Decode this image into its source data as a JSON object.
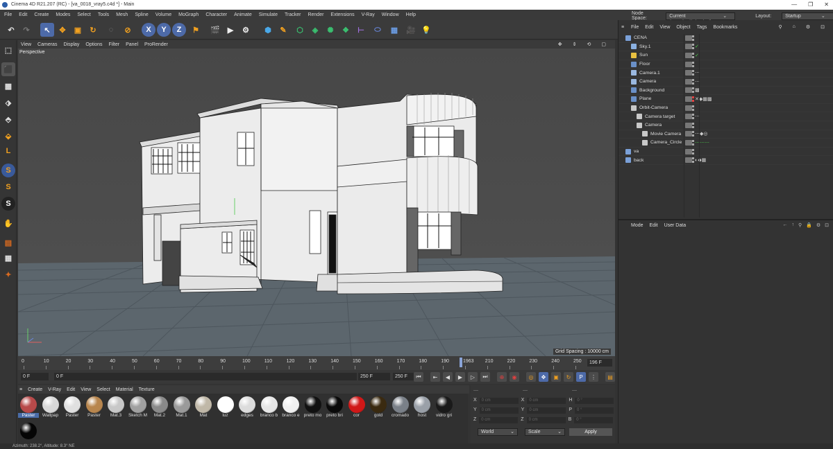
{
  "window": {
    "title": "Cinema 4D R21.207 (RC) - [va_0018_vray5.c4d *] - Main"
  },
  "menu": [
    "File",
    "Edit",
    "Create",
    "Modes",
    "Select",
    "Tools",
    "Mesh",
    "Spline",
    "Volume",
    "MoGraph",
    "Character",
    "Animate",
    "Simulate",
    "Tracker",
    "Render",
    "Extensions",
    "V-Ray",
    "Window",
    "Help"
  ],
  "node_space": {
    "label": "Node Space:",
    "value": "Current (Standard/Physical)"
  },
  "layout": {
    "label": "Layout:",
    "value": "Startup"
  },
  "viewport": {
    "menu": [
      "View",
      "Cameras",
      "Display",
      "Options",
      "Filter",
      "Panel",
      "ProRender"
    ],
    "label": "Perspective",
    "grid_spacing": "Grid Spacing : 10000 cm"
  },
  "timeline": {
    "ticks": [
      "0",
      "10",
      "20",
      "30",
      "40",
      "50",
      "60",
      "70",
      "80",
      "90",
      "100",
      "110",
      "120",
      "130",
      "140",
      "150",
      "160",
      "170",
      "180",
      "190",
      "1963",
      "210",
      "220",
      "230",
      "240",
      "250"
    ],
    "current_frame": "196 F"
  },
  "transport": {
    "start": "0 F",
    "current": "0 F",
    "end": "250 F",
    "end2": "250 F"
  },
  "materials": {
    "menu": [
      "Create",
      "V-Ray",
      "Edit",
      "View",
      "Select",
      "Material",
      "Texture"
    ],
    "items": [
      {
        "name": "Paster",
        "color": "#b84a4a"
      },
      {
        "name": "Wallpap",
        "color": "#d8d8d8"
      },
      {
        "name": "Paster",
        "color": "#e0e0e0"
      },
      {
        "name": "Paster",
        "color": "#b8864e"
      },
      {
        "name": "Mat.3",
        "color": "#c8c8c8"
      },
      {
        "name": "Sketch M",
        "color": "#a0a0a0"
      },
      {
        "name": "Mat.2",
        "color": "#8a8a8a"
      },
      {
        "name": "Mat.1",
        "color": "#9a9a9a"
      },
      {
        "name": "Mat",
        "color": "#c0b8a8"
      },
      {
        "name": "luz",
        "color": "#ffffff"
      },
      {
        "name": "edges",
        "color": "#dcdcdc"
      },
      {
        "name": "branco b",
        "color": "#e6e6e6"
      },
      {
        "name": "branco e",
        "color": "#f0f0f0"
      },
      {
        "name": "preto mo",
        "color": "#111111"
      },
      {
        "name": "preto bri",
        "color": "#0a0a0a"
      },
      {
        "name": "cor",
        "color": "#d01818"
      },
      {
        "name": "gold",
        "color": "#3a2a10"
      },
      {
        "name": "cromado",
        "color": "#7a8088"
      },
      {
        "name": "host",
        "color": "#9aa0a8"
      },
      {
        "name": "vidro gri",
        "color": "#1a1a1a"
      },
      {
        "name": "",
        "color": "#050505"
      }
    ]
  },
  "coords": {
    "rows": [
      {
        "a": "X",
        "av": "0 cm",
        "b": "X",
        "bv": "0 cm",
        "c": "H",
        "cv": "0 °"
      },
      {
        "a": "Y",
        "av": "0 cm",
        "b": "Y",
        "bv": "0 cm",
        "c": "P",
        "cv": "0 °"
      },
      {
        "a": "Z",
        "av": "0 cm",
        "b": "Z",
        "bv": "0 cm",
        "c": "B",
        "cv": "0 °"
      }
    ],
    "mode1": "World",
    "mode2": "Scale",
    "apply": "Apply"
  },
  "object_manager": {
    "menu": [
      "File",
      "Edit",
      "View",
      "Object",
      "Tags",
      "Bookmarks"
    ],
    "objects": [
      {
        "name": "CENA",
        "indent": 0,
        "icon": "#7aa0d8"
      },
      {
        "name": "Sky.1",
        "indent": 1,
        "icon": "#8ab0e0"
      },
      {
        "name": "Sun",
        "indent": 1,
        "icon": "#e8c040"
      },
      {
        "name": "Floor",
        "indent": 1,
        "icon": "#6a90c8"
      },
      {
        "name": "Camera.1",
        "indent": 1,
        "icon": "#9ab8e0"
      },
      {
        "name": "Camera",
        "indent": 1,
        "icon": "#9ab8e0"
      },
      {
        "name": "Background",
        "indent": 1,
        "icon": "#6a90c8"
      },
      {
        "name": "Plane",
        "indent": 1,
        "icon": "#6a90c8"
      },
      {
        "name": "Orbit-Camera",
        "indent": 1,
        "icon": "#c8c8c8"
      },
      {
        "name": "Camera target",
        "indent": 2,
        "icon": "#c8c8c8"
      },
      {
        "name": "Camera",
        "indent": 2,
        "icon": "#c8c8c8"
      },
      {
        "name": "Movie Camera",
        "indent": 3,
        "icon": "#c8c8c8"
      },
      {
        "name": "Camera_Circle",
        "indent": 3,
        "icon": "#c8c8c8"
      },
      {
        "name": "va",
        "indent": 0,
        "icon": "#7aa0d8"
      },
      {
        "name": "back",
        "indent": 0,
        "icon": "#7aa0d8"
      }
    ]
  },
  "attributes": {
    "menu": [
      "Mode",
      "Edit",
      "User Data"
    ]
  },
  "status": "Azimuth: 238.2°, Altitude: 8.3° NE"
}
